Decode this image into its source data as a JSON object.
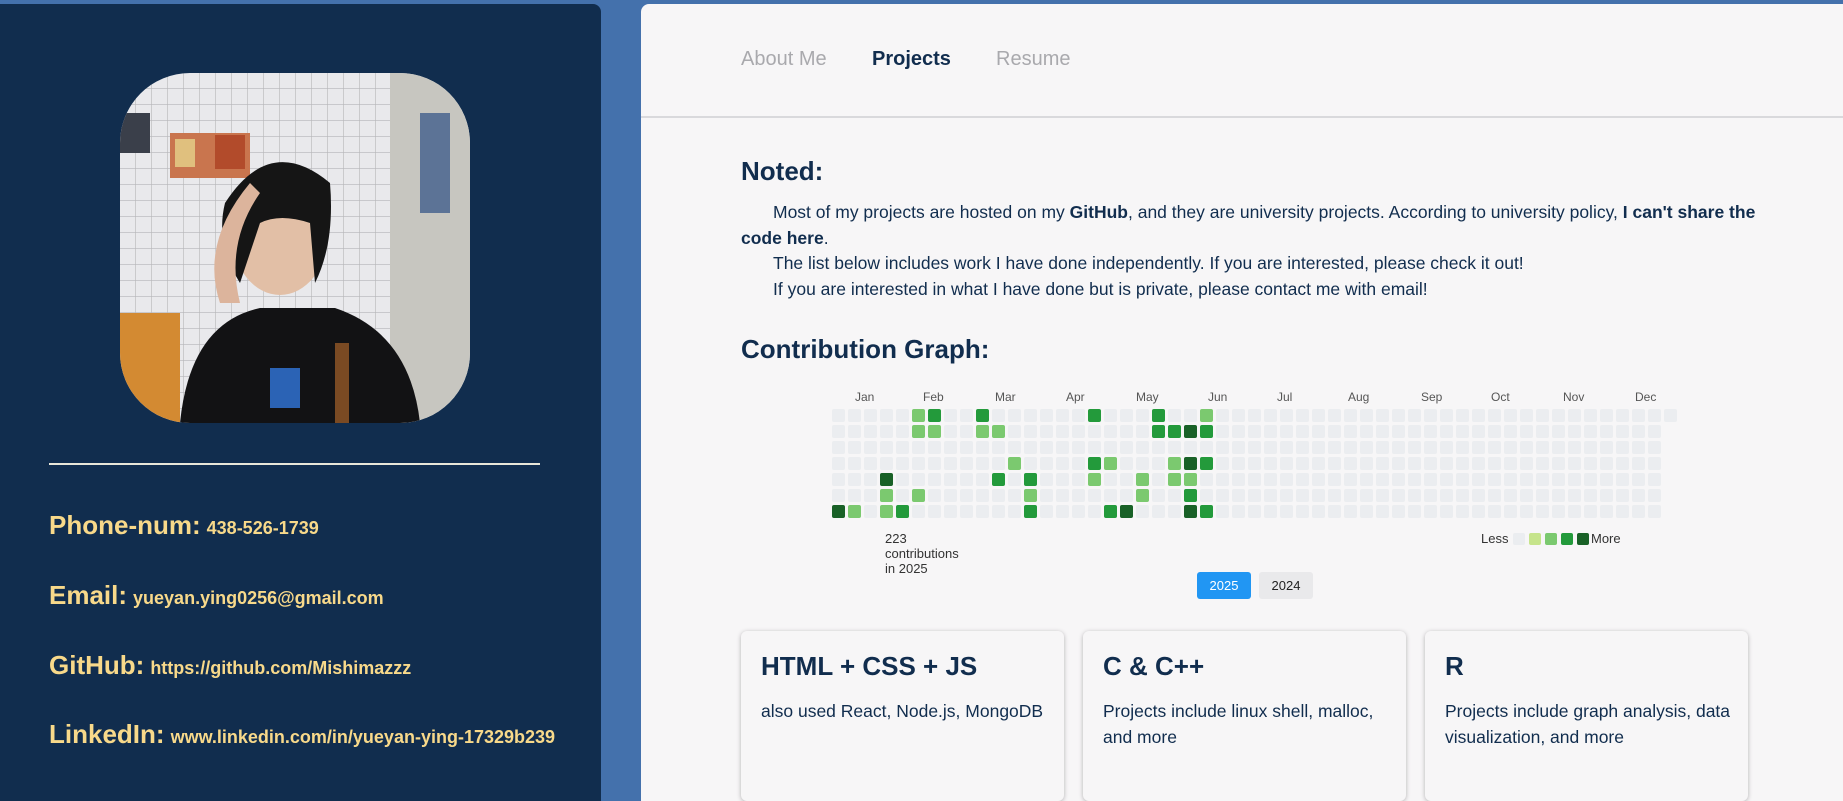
{
  "sidebar": {
    "contacts": [
      {
        "label": "Phone-num:",
        "value": "438-526-1739"
      },
      {
        "label": "Email:",
        "value": "yueyan.ying0256@gmail.com"
      },
      {
        "label": "GitHub:",
        "value": "https://github.com/Mishimazzz"
      },
      {
        "label": "LinkedIn:",
        "value": "www.linkedin.com/in/yueyan-ying-17329b239"
      }
    ]
  },
  "nav": {
    "items": [
      {
        "label": "About Me",
        "active": false
      },
      {
        "label": "Projects",
        "active": true
      },
      {
        "label": "Resume",
        "active": false
      }
    ]
  },
  "noted": {
    "heading": "Noted:",
    "line1_a": "Most of my projects are hosted on my ",
    "line1_b": "GitHub",
    "line1_c": ", and they are university projects. According to university policy, ",
    "line1_d": "I can't share the code here",
    "line1_e": ".",
    "line2": "The list below includes work I have done independently. If you are interested, please check it out!",
    "line3": "If you are interested in what I have done but is private, please contact me with email!"
  },
  "contribution": {
    "heading": "Contribution Graph:",
    "months": [
      "Jan",
      "Feb",
      "Mar",
      "Apr",
      "May",
      "Jun",
      "Jul",
      "Aug",
      "Sep",
      "Oct",
      "Nov",
      "Dec"
    ],
    "total_text": "223 contributions in 2025",
    "legend_less": "Less",
    "legend_more": "More",
    "colors": [
      "#ebedf0",
      "#c6e48b",
      "#7bc96f",
      "#239a3b",
      "#196127"
    ],
    "cells": [
      [
        5,
        0,
        2
      ],
      [
        5,
        1,
        2
      ],
      [
        6,
        0,
        3
      ],
      [
        6,
        1,
        2
      ],
      [
        9,
        0,
        3
      ],
      [
        9,
        1,
        2
      ],
      [
        10,
        1,
        2
      ],
      [
        11,
        3,
        2
      ],
      [
        16,
        0,
        3
      ],
      [
        16,
        3,
        3
      ],
      [
        17,
        3,
        2
      ],
      [
        20,
        0,
        3
      ],
      [
        20,
        1,
        3
      ],
      [
        21,
        1,
        3
      ],
      [
        21,
        3,
        2
      ],
      [
        21,
        4,
        2
      ],
      [
        22,
        1,
        4
      ],
      [
        22,
        3,
        4
      ],
      [
        22,
        4,
        2
      ],
      [
        23,
        0,
        2
      ],
      [
        23,
        1,
        3
      ],
      [
        23,
        3,
        3
      ],
      [
        3,
        4,
        4
      ],
      [
        10,
        4,
        3
      ],
      [
        12,
        4,
        3
      ],
      [
        16,
        4,
        2
      ],
      [
        19,
        4,
        2
      ],
      [
        22,
        5,
        3
      ],
      [
        3,
        5,
        2
      ],
      [
        5,
        5,
        2
      ],
      [
        12,
        5,
        2
      ],
      [
        19,
        5,
        2
      ],
      [
        0,
        6,
        4
      ],
      [
        1,
        6,
        2
      ],
      [
        3,
        6,
        2
      ],
      [
        4,
        6,
        3
      ],
      [
        12,
        6,
        3
      ],
      [
        17,
        6,
        3
      ],
      [
        18,
        6,
        4
      ],
      [
        22,
        6,
        4
      ],
      [
        23,
        6,
        3
      ],
      [
        4,
        7,
        2
      ],
      [
        5,
        7,
        3
      ],
      [
        9,
        7,
        4
      ],
      [
        18,
        7,
        3
      ],
      [
        22,
        7,
        3
      ],
      [
        23,
        7,
        2
      ],
      [
        24,
        7,
        2
      ],
      [
        25,
        7,
        2
      ],
      [
        26,
        7,
        3
      ]
    ],
    "years": [
      {
        "label": "2025",
        "active": true
      },
      {
        "label": "2024",
        "active": false
      }
    ]
  },
  "projects": [
    {
      "title": "HTML + CSS + JS",
      "desc": "also used React, Node.js, MongoDB"
    },
    {
      "title": "C & C++",
      "desc": "Projects include linux shell, malloc, and more"
    },
    {
      "title": "R",
      "desc": "Projects include graph analysis, data visualization, and more"
    }
  ]
}
